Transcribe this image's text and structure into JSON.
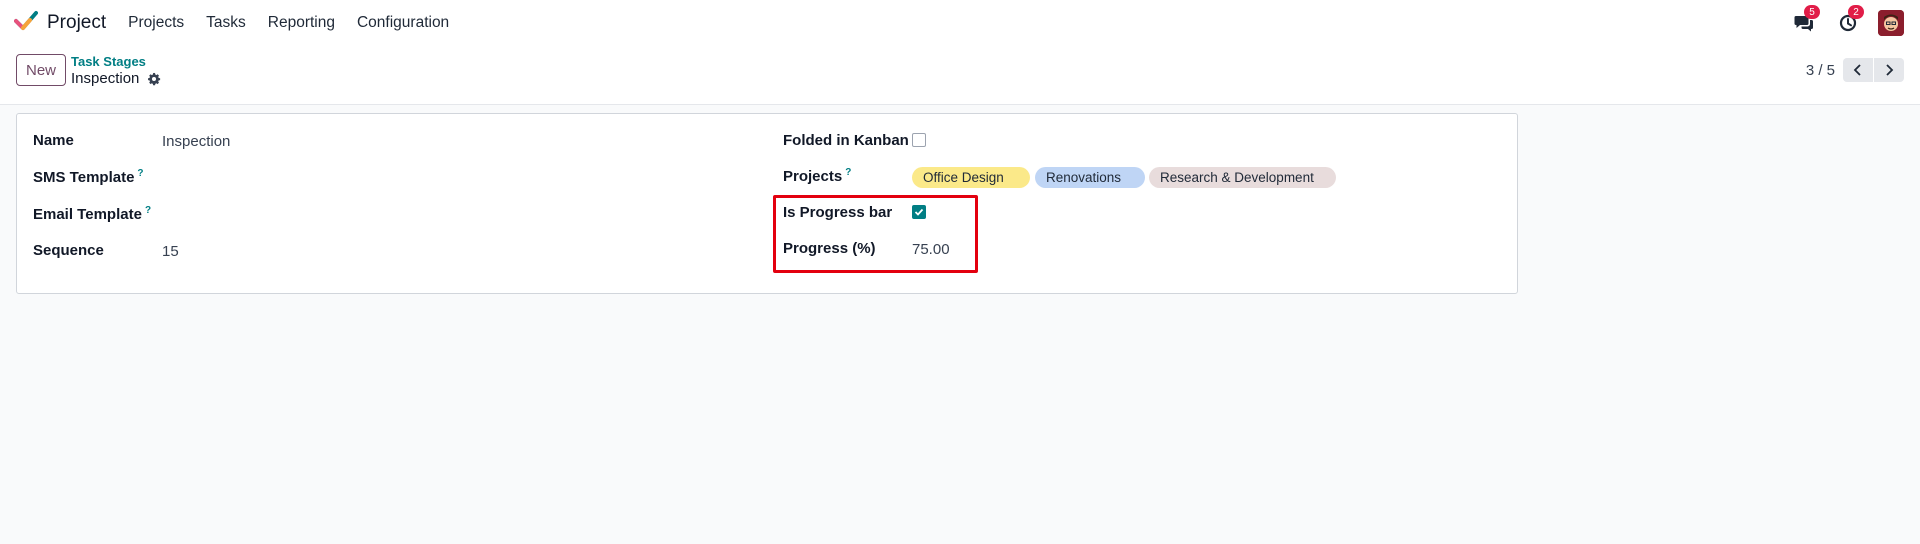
{
  "navbar": {
    "app_name": "Project",
    "menu": [
      "Projects",
      "Tasks",
      "Reporting",
      "Configuration"
    ],
    "messages_count": "5",
    "activities_count": "2"
  },
  "control_panel": {
    "new_label": "New",
    "breadcrumb_parent": "Task Stages",
    "breadcrumb_current": "Inspection",
    "pager_value": "3 / 5"
  },
  "form": {
    "name_label": "Name",
    "name_value": "Inspection",
    "sms_template_label": "SMS Template",
    "email_template_label": "Email Template",
    "sequence_label": "Sequence",
    "sequence_value": "15",
    "folded_label": "Folded in Kanban",
    "folded_checked": false,
    "projects_label": "Projects",
    "projects": [
      {
        "name": "Office Design",
        "color": "#fbe989"
      },
      {
        "name": "Renovations",
        "color": "#bfd5f5"
      },
      {
        "name": "Research & Development",
        "color": "#e8dcdc"
      }
    ],
    "is_progress_bar_label": "Is Progress bar",
    "is_progress_bar_checked": true,
    "progress_label": "Progress (%)",
    "progress_value": "75.00",
    "help_mark": "?"
  },
  "colors": {
    "brand": "#714b67",
    "accent": "#017e84",
    "highlight": "#e3000f",
    "badge": "#e11d48"
  }
}
